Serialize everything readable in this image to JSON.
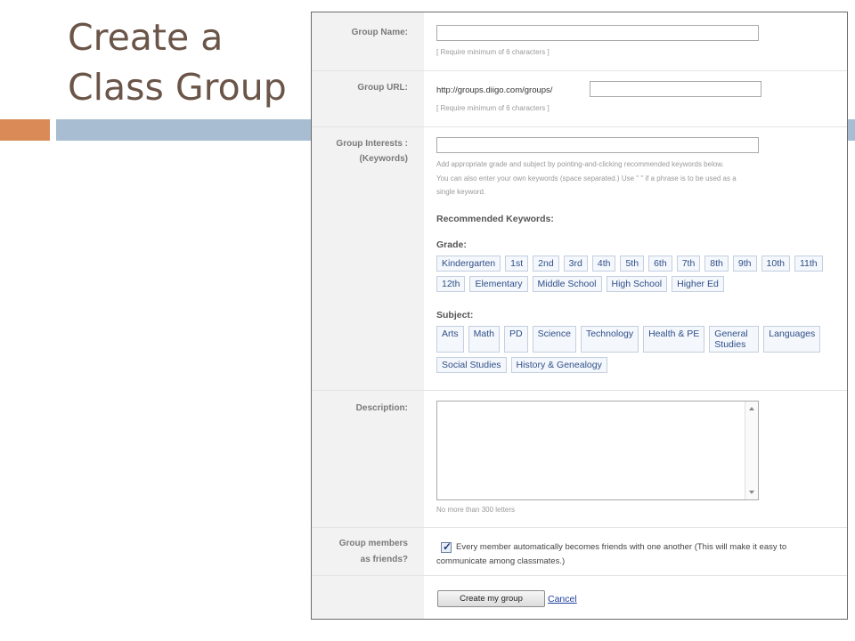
{
  "slide": {
    "title_line1": "Create a",
    "title_line2": "Class Group"
  },
  "form": {
    "group_name_label": "Group Name:",
    "group_name_value": "",
    "group_name_hint": "[ Require minimum of 6 characters ]",
    "group_url_label": "Group URL:",
    "group_url_prefix": "http://groups.diigo.com/groups/",
    "group_url_value": "",
    "group_url_hint": "[ Require minimum of 6 characters ]",
    "interests_label_line1": "Group Interests :",
    "interests_label_line2": "(Keywords)",
    "interests_value": "",
    "interests_hint_line1": "Add appropriate grade and subject by pointing-and-clicking recommended keywords below.",
    "interests_hint_line2": "You can also enter your own keywords (space separated.) Use \" \" if a phrase is to be used as a",
    "interests_hint_line3": "single keyword.",
    "recommended_label": "Recommended Keywords:",
    "grade_label": "Grade:",
    "grades": [
      "Kindergarten",
      "1st",
      "2nd",
      "3rd",
      "4th",
      "5th",
      "6th",
      "7th",
      "8th",
      "9th",
      "10th",
      "11th",
      "12th",
      "Elementary",
      "Middle School",
      "High School",
      "Higher Ed"
    ],
    "subject_label": "Subject:",
    "subjects": [
      "Arts",
      "Math",
      "PD",
      "Science",
      "Technology",
      "Health & PE",
      "General Studies",
      "Languages",
      "Social Studies",
      "History & Genealogy"
    ],
    "description_label": "Description:",
    "description_value": "",
    "description_hint": "No more than 300 letters",
    "friends_label_line1": "Group members",
    "friends_label_line2": "as friends?",
    "friends_checked": true,
    "friends_text": "Every member automatically becomes friends with one another (This will make it easy to communicate among classmates.)",
    "create_button": "Create my group",
    "cancel_link": "Cancel"
  },
  "colors": {
    "title": "#6b5548",
    "accent_orange": "#d98a56",
    "accent_blue": "#a8bdd2",
    "chip_text": "#2f4f8a",
    "link": "#1f3fa0"
  },
  "icons": {
    "scroll_up": "triangle-up-icon",
    "scroll_down": "triangle-down-icon",
    "checkmark": "checkmark-icon"
  }
}
